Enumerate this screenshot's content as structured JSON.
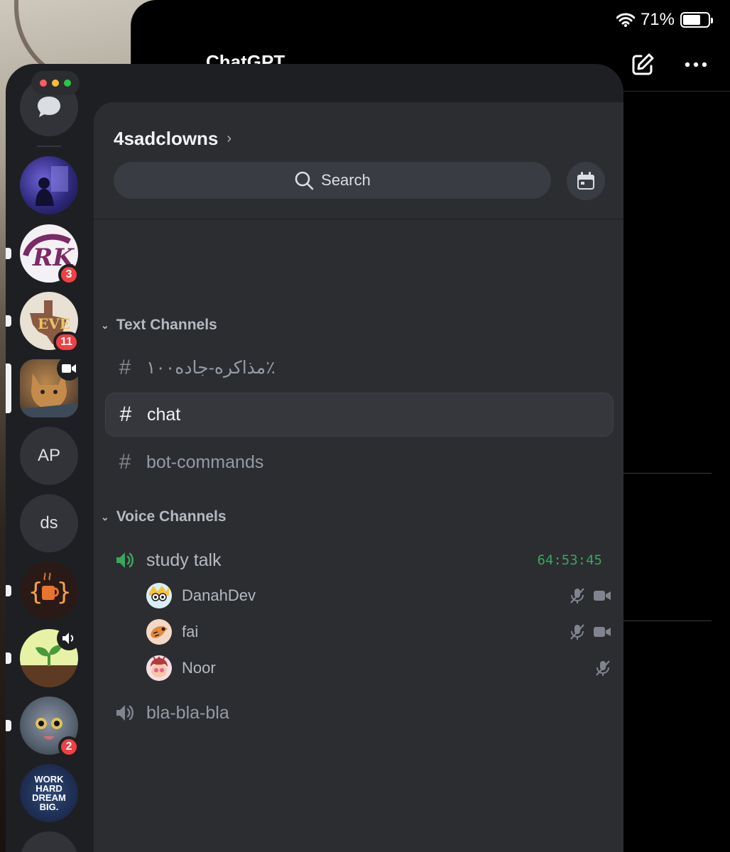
{
  "status_bar": {
    "battery": "71%",
    "battery_level": 0.71
  },
  "background_app": {
    "title": "ChatGPT"
  },
  "rail": {
    "servers": [
      {
        "id": "dm",
        "icon": "chat-bubble-icon"
      },
      {
        "id": "server-night"
      },
      {
        "id": "server-rk",
        "badge": "3",
        "unread": true
      },
      {
        "id": "server-texas",
        "badge": "11",
        "unread": true
      },
      {
        "id": "server-cat",
        "selected": true,
        "live": "video-icon"
      },
      {
        "id": "server-ap",
        "label": "AP"
      },
      {
        "id": "server-ds",
        "label": "ds"
      },
      {
        "id": "server-coffee",
        "unread": true
      },
      {
        "id": "server-plant",
        "unread": true,
        "live": "speaker-icon"
      },
      {
        "id": "server-catmeme",
        "badge": "2",
        "unread": true
      },
      {
        "id": "server-work",
        "label_lines": [
          "WORK",
          "HARD",
          "DREAM",
          "BIG."
        ]
      }
    ]
  },
  "panel": {
    "server_name": "4sadclowns",
    "search_placeholder": "Search",
    "categories": {
      "text": "Text Channels",
      "voice": "Voice Channels"
    },
    "text_channels": [
      {
        "name": "مذاکره-جاده۱۰۰٪"
      },
      {
        "name": "chat",
        "active": true
      },
      {
        "name": "bot-commands"
      }
    ],
    "voice_channels": [
      {
        "name": "study talk",
        "timer": "64:53:45",
        "users": [
          {
            "name": "DanahDev",
            "muted": true,
            "video": true
          },
          {
            "name": "fai",
            "muted": true,
            "video": true
          },
          {
            "name": "Noor",
            "muted": true,
            "video": false
          }
        ]
      },
      {
        "name": "bla-bla-bla"
      }
    ]
  },
  "colors": {
    "accent_green": "#3ba55d",
    "badge_red": "#f23f43",
    "panel_bg": "#2b2d31",
    "rail_bg": "#1e1f22"
  }
}
